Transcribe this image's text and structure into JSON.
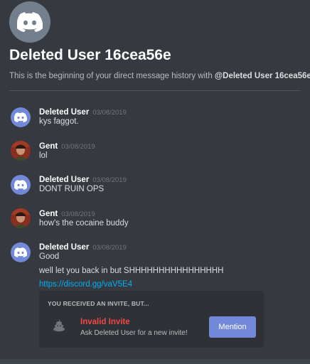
{
  "header": {
    "title": "Deleted User 16cea56e",
    "intro_prefix": "This is the beginning of your direct message history with ",
    "intro_user": "@Deleted User 16cea56e",
    "intro_suffix": "."
  },
  "messages": [
    {
      "author": "Deleted User",
      "time": "03/08/2019",
      "lines": [
        "kys faggot."
      ],
      "avatar": "discord-logo-icon"
    },
    {
      "author": "Gent",
      "time": "03/08/2019",
      "lines": [
        "lol"
      ],
      "avatar": "user-avatar"
    },
    {
      "author": "Deleted User",
      "time": "03/08/2019",
      "lines": [
        "DONT RUIN OPS"
      ],
      "avatar": "discord-logo-icon"
    },
    {
      "author": "Gent",
      "time": "03/08/2019",
      "lines": [
        "how's the cocaine buddy"
      ],
      "avatar": "user-avatar"
    },
    {
      "author": "Deleted User",
      "time": "03/08/2019",
      "lines": [
        "Good",
        "well let you back in but SHHHHHHHHHHHHHHHH"
      ],
      "link": "https://discord.gg/vaV5E4",
      "avatar": "discord-logo-icon"
    }
  ],
  "invite": {
    "heading": "YOU RECEIVED AN INVITE, BUT...",
    "title": "Invalid Invite",
    "subtitle": "Ask Deleted User for a new invite!",
    "button_label": "Mention",
    "icon": "poop-icon"
  },
  "colors": {
    "background": "#36393f",
    "blurple": "#7289da",
    "error": "#f04747",
    "link": "#00b0f4"
  }
}
